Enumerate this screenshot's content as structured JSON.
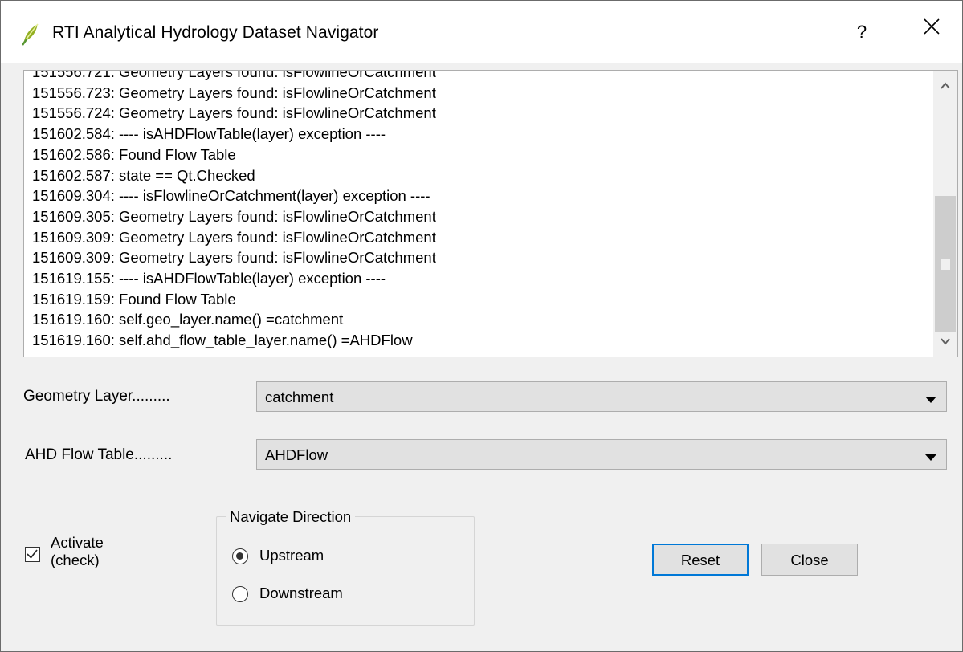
{
  "window": {
    "title": "RTI Analytical Hydrology Dataset Navigator",
    "help_label": "?",
    "icon": "qgis-leaf-icon"
  },
  "log": {
    "lines": [
      "151556.721: Geometry Layers found: isFlowlineOrCatchment",
      "151556.723: Geometry Layers found: isFlowlineOrCatchment",
      "151556.724: Geometry Layers found: isFlowlineOrCatchment",
      "151602.584: ---- isAHDFlowTable(layer) exception ----",
      "151602.586: Found Flow Table",
      "151602.587: state == Qt.Checked",
      "151609.304: ---- isFlowlineOrCatchment(layer) exception ----",
      "151609.305: Geometry Layers found: isFlowlineOrCatchment",
      "151609.309: Geometry Layers found: isFlowlineOrCatchment",
      "151609.309: Geometry Layers found: isFlowlineOrCatchment",
      "151619.155: ---- isAHDFlowTable(layer) exception ----",
      "151619.159: Found Flow Table",
      "151619.160: self.geo_layer.name() =catchment",
      "151619.160: self.ahd_flow_table_layer.name() =AHDFlow"
    ]
  },
  "form": {
    "geometry_layer_label": "Geometry Layer.........",
    "geometry_layer_value": "catchment",
    "flow_table_label": "AHD Flow Table.........",
    "flow_table_value": "AHDFlow"
  },
  "activate": {
    "label_line1": "Activate",
    "label_line2": "(check)",
    "checked": true
  },
  "direction": {
    "title": "Navigate Direction",
    "options": [
      {
        "label": "Upstream",
        "selected": true
      },
      {
        "label": "Downstream",
        "selected": false
      }
    ]
  },
  "buttons": {
    "reset": "Reset",
    "close": "Close"
  },
  "colors": {
    "accent": "#0078d7",
    "dialog_bg": "#f0f0f0",
    "button_bg": "#e1e1e1"
  }
}
